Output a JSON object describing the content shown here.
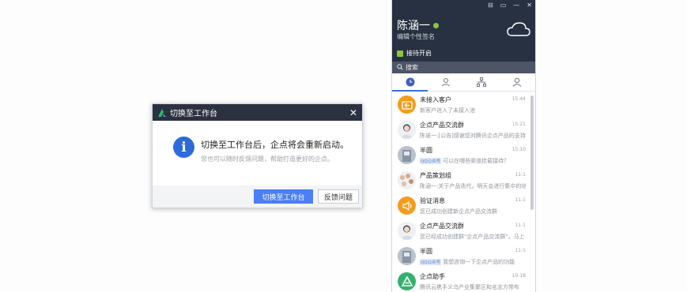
{
  "dialog": {
    "title": "切换至工作台",
    "close_glyph": "✕",
    "info_glyph": "i",
    "message": "切换至工作台后，企点将会重新启动。",
    "sub_message": "您也可以随时反馈问题，帮助打造更好的企点。",
    "primary_label": "切换至工作台",
    "secondary_label": "反馈问题"
  },
  "panel": {
    "window_buttons": [
      "⊟",
      "▭",
      "—",
      "✕"
    ],
    "username": "陈涵一",
    "signature": "编辑个性签名",
    "reception": "接待开启",
    "search_placeholder": "搜索",
    "search_icon": "search-icon",
    "tabs": [
      {
        "icon": "clock-icon"
      },
      {
        "icon": "contacts-icon"
      },
      {
        "icon": "org-icon"
      },
      {
        "icon": "user-icon"
      }
    ],
    "items": [
      {
        "name": "未接入客户",
        "time": "15:44",
        "msg": "新客户进入了未接入池",
        "badge": "",
        "avatar": "orange",
        "icon": "customer-icon"
      },
      {
        "name": "企点产品交流群",
        "time": "15:21",
        "msg": "陈诺一:[公告]感谢您对腾讯企点产品的支持",
        "badge": "",
        "avatar": "light",
        "icon": "group-avatar"
      },
      {
        "name": "半圆",
        "time": "15:10",
        "msg": "可以在哪些渠道挂载接待？",
        "badge": "QQ公众号",
        "avatar": "gray",
        "icon": "person-avatar"
      },
      {
        "name": "产品策划组",
        "time": "11-1",
        "msg": "陈涵一:关于产品迭代，明天会进行集中的培",
        "badge": "",
        "avatar": "light",
        "icon": "team-avatar"
      },
      {
        "name": "验证消息",
        "time": "11-1",
        "msg": "您已成功创建新企点产品交流群",
        "badge": "",
        "avatar": "orange",
        "icon": "speaker-icon"
      },
      {
        "name": "企点产品交流群",
        "time": "11-1",
        "msg": "您已经成功创建群\"企点产品交流群\"，马上",
        "badge": "",
        "avatar": "light",
        "icon": "group-avatar"
      },
      {
        "name": "半圆",
        "time": "11-1",
        "msg": "我想咨询一下企点产品的功能",
        "badge": "QQ公众号",
        "avatar": "gray",
        "icon": "person-avatar"
      },
      {
        "name": "企点助手",
        "time": "10-18",
        "msg": "腾讯云携手义乌产业集聚区和名志方带布",
        "badge": "",
        "avatar": "green",
        "icon": "assistant-icon"
      }
    ]
  }
}
